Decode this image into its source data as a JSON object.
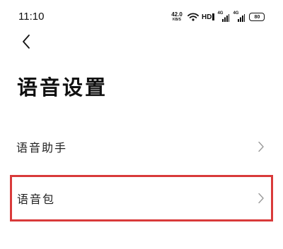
{
  "status_bar": {
    "time": "11:10",
    "net_speed_value": "42.0",
    "net_speed_unit": "KB/S",
    "hd_label": "HD",
    "sim1_tag": "4G",
    "sim2_tag": "4G",
    "battery_level": "80"
  },
  "header": {
    "back_icon": "chevron-left-icon",
    "title": "语音设置"
  },
  "list": {
    "items": [
      {
        "label": "语音助手",
        "icon": "chevron-right-icon"
      },
      {
        "label": "语音包",
        "icon": "chevron-right-icon",
        "highlighted": true
      }
    ]
  },
  "colors": {
    "background": "#ffffff",
    "text": "#111111",
    "chevron": "#9a9a9a",
    "highlight_border": "#d93a3a"
  }
}
